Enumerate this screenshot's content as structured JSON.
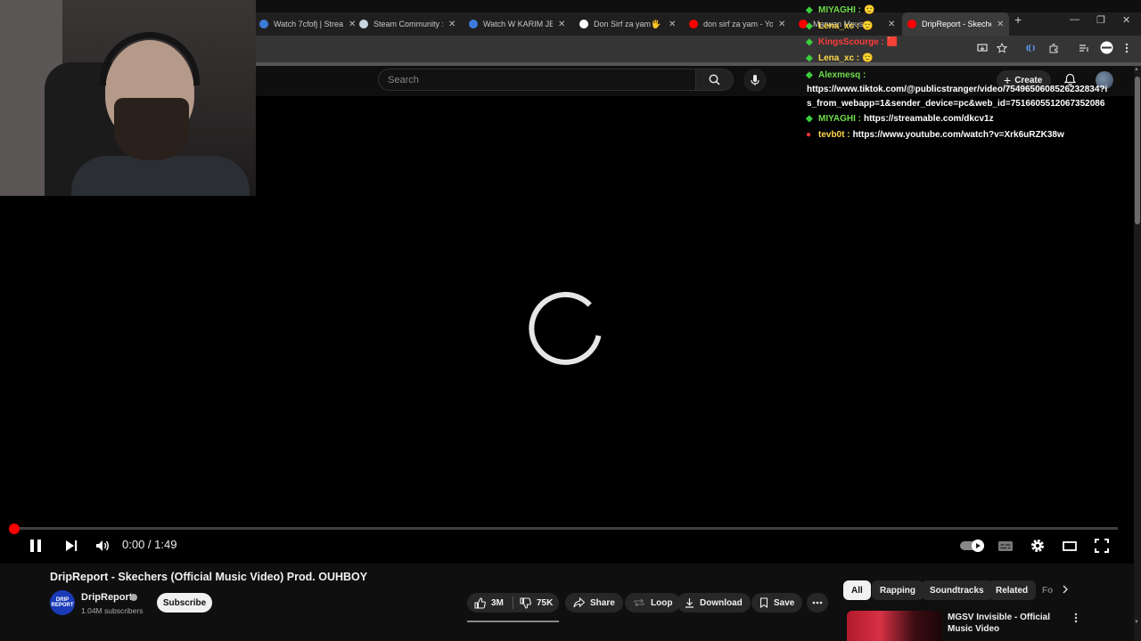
{
  "browser": {
    "tabs": [
      {
        "title": "Watch 7cfofj | Stream",
        "color": "#3d7bd9"
      },
      {
        "title": "Steam Community :: ",
        "color": "#c7d5e0"
      },
      {
        "title": "Watch W KARIM JEHA",
        "color": "#3d7bd9"
      },
      {
        "title": "Don Sirf za yam🖐 - ",
        "color": "#ffffff"
      },
      {
        "title": "don sirf za yam - You",
        "color": "#ff0000"
      },
      {
        "title": "Marwan Moussa",
        "color": "#ff0000"
      },
      {
        "title": "DripReport - Skecher",
        "color": "#ff0000"
      }
    ],
    "new_tab_icon": "plus-icon",
    "window_controls": [
      "minimize-icon",
      "restore-icon",
      "close-icon"
    ],
    "close_glyph": "✕",
    "new_tab_glyph": "+",
    "minimize_glyph": "—",
    "restore_glyph": "❐"
  },
  "masthead": {
    "search_placeholder": "Search",
    "create_label": "Create"
  },
  "chat": [
    {
      "user": "MIYAGHI",
      "user_color": "#6fdc4b",
      "badge": "◆",
      "msg": "🙂"
    },
    {
      "user": "Lena_xc",
      "user_color": "#ffd84a",
      "badge": "◆",
      "msg": "🙂"
    },
    {
      "user": "KingsScourge",
      "user_color": "#ff3b3b",
      "badge": "◆",
      "msg": "🟥"
    },
    {
      "user": "Lena_xc",
      "user_color": "#ffd84a",
      "badge": "◆",
      "msg": "🙂"
    },
    {
      "user": "Alexmesq",
      "user_color": "#6fdc4b",
      "badge": "◆",
      "msg": "https://www.tiktok.com/@publicstranger/video/7549650608526232834?is_from_webapp=1&sender_device=pc&web_id=7516605512067352086"
    },
    {
      "user": "MIYAGHI",
      "user_color": "#6fdc4b",
      "badge": "◆",
      "msg": "https://streamable.com/dkcv1z"
    },
    {
      "user": "tevb0t",
      "user_color": "#ffd84a",
      "badge": "●",
      "msg": "https://www.youtube.com/watch?v=Xrk6uRZK38w"
    }
  ],
  "player": {
    "current_time": "0:00",
    "duration": "1:49",
    "time_display": "0:00 / 1:49",
    "progress": 0,
    "state": "loading"
  },
  "video": {
    "title": "DripReport - Skechers (Official Music Video) Prod. OUHBOY",
    "channel": "DripReport",
    "channel_logo_text": "DRIP REPORT",
    "subscribers": "1.04M subscribers",
    "subscribe_label": "Subscribe",
    "likes": "3M",
    "dislikes": "75K",
    "share_label": "Share",
    "loop_label": "Loop",
    "download_label": "Download",
    "save_label": "Save"
  },
  "chips": [
    "All",
    "Rapping",
    "Soundtracks",
    "Related",
    "Fo"
  ],
  "recommendation": {
    "title": "MGSV Invisible - Official Music Video"
  },
  "colors": {
    "accent": "#ff0000",
    "chat_badge": "#3ccc3c"
  }
}
